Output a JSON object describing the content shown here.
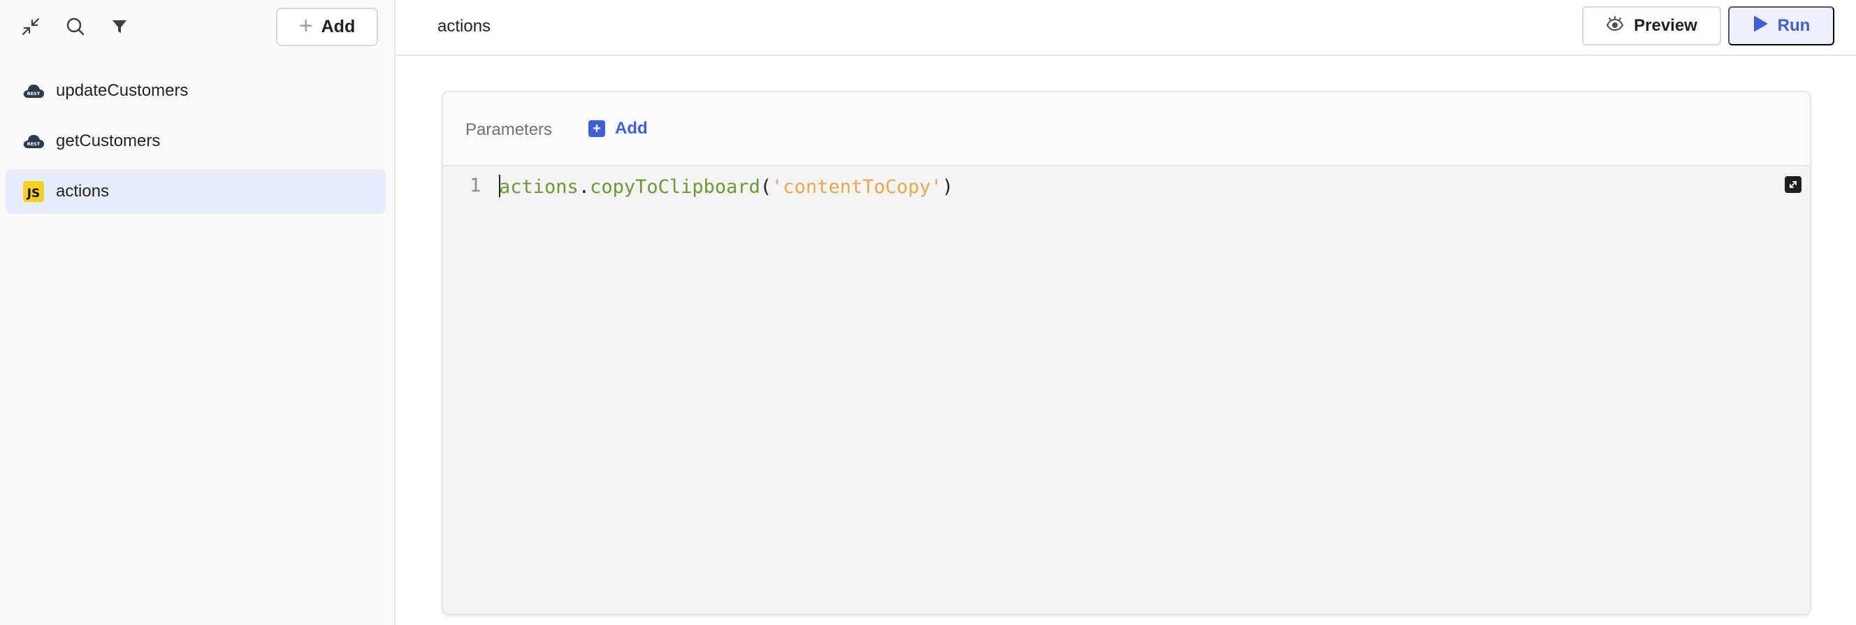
{
  "sidebar": {
    "toolbar": {
      "collapse_icon": "collapse-icon",
      "search_icon": "search-icon",
      "filter_icon": "filter-icon",
      "add_label": "Add"
    },
    "items": [
      {
        "label": "updateCustomers",
        "icon": "rest-api-icon",
        "active": false
      },
      {
        "label": "getCustomers",
        "icon": "rest-api-icon",
        "active": false
      },
      {
        "label": "actions",
        "icon": "js-icon",
        "icon_text": "JS",
        "active": true
      }
    ]
  },
  "header": {
    "title": "actions",
    "preview_label": "Preview",
    "run_label": "Run"
  },
  "panel": {
    "parameters_label": "Parameters",
    "add_label": "Add",
    "editor": {
      "line_number": "1",
      "code": {
        "object": "actions",
        "dot": ".",
        "method": "copyToClipboard",
        "open_paren": "(",
        "argument": "'contentToCopy'",
        "close_paren": ")"
      }
    }
  },
  "colors": {
    "accent": "#3f5ed8",
    "active_item_bg": "#e8edfc",
    "js_badge": "#f7d21c",
    "code_identifier": "#6b9a2e",
    "code_string": "#e8a94b"
  }
}
